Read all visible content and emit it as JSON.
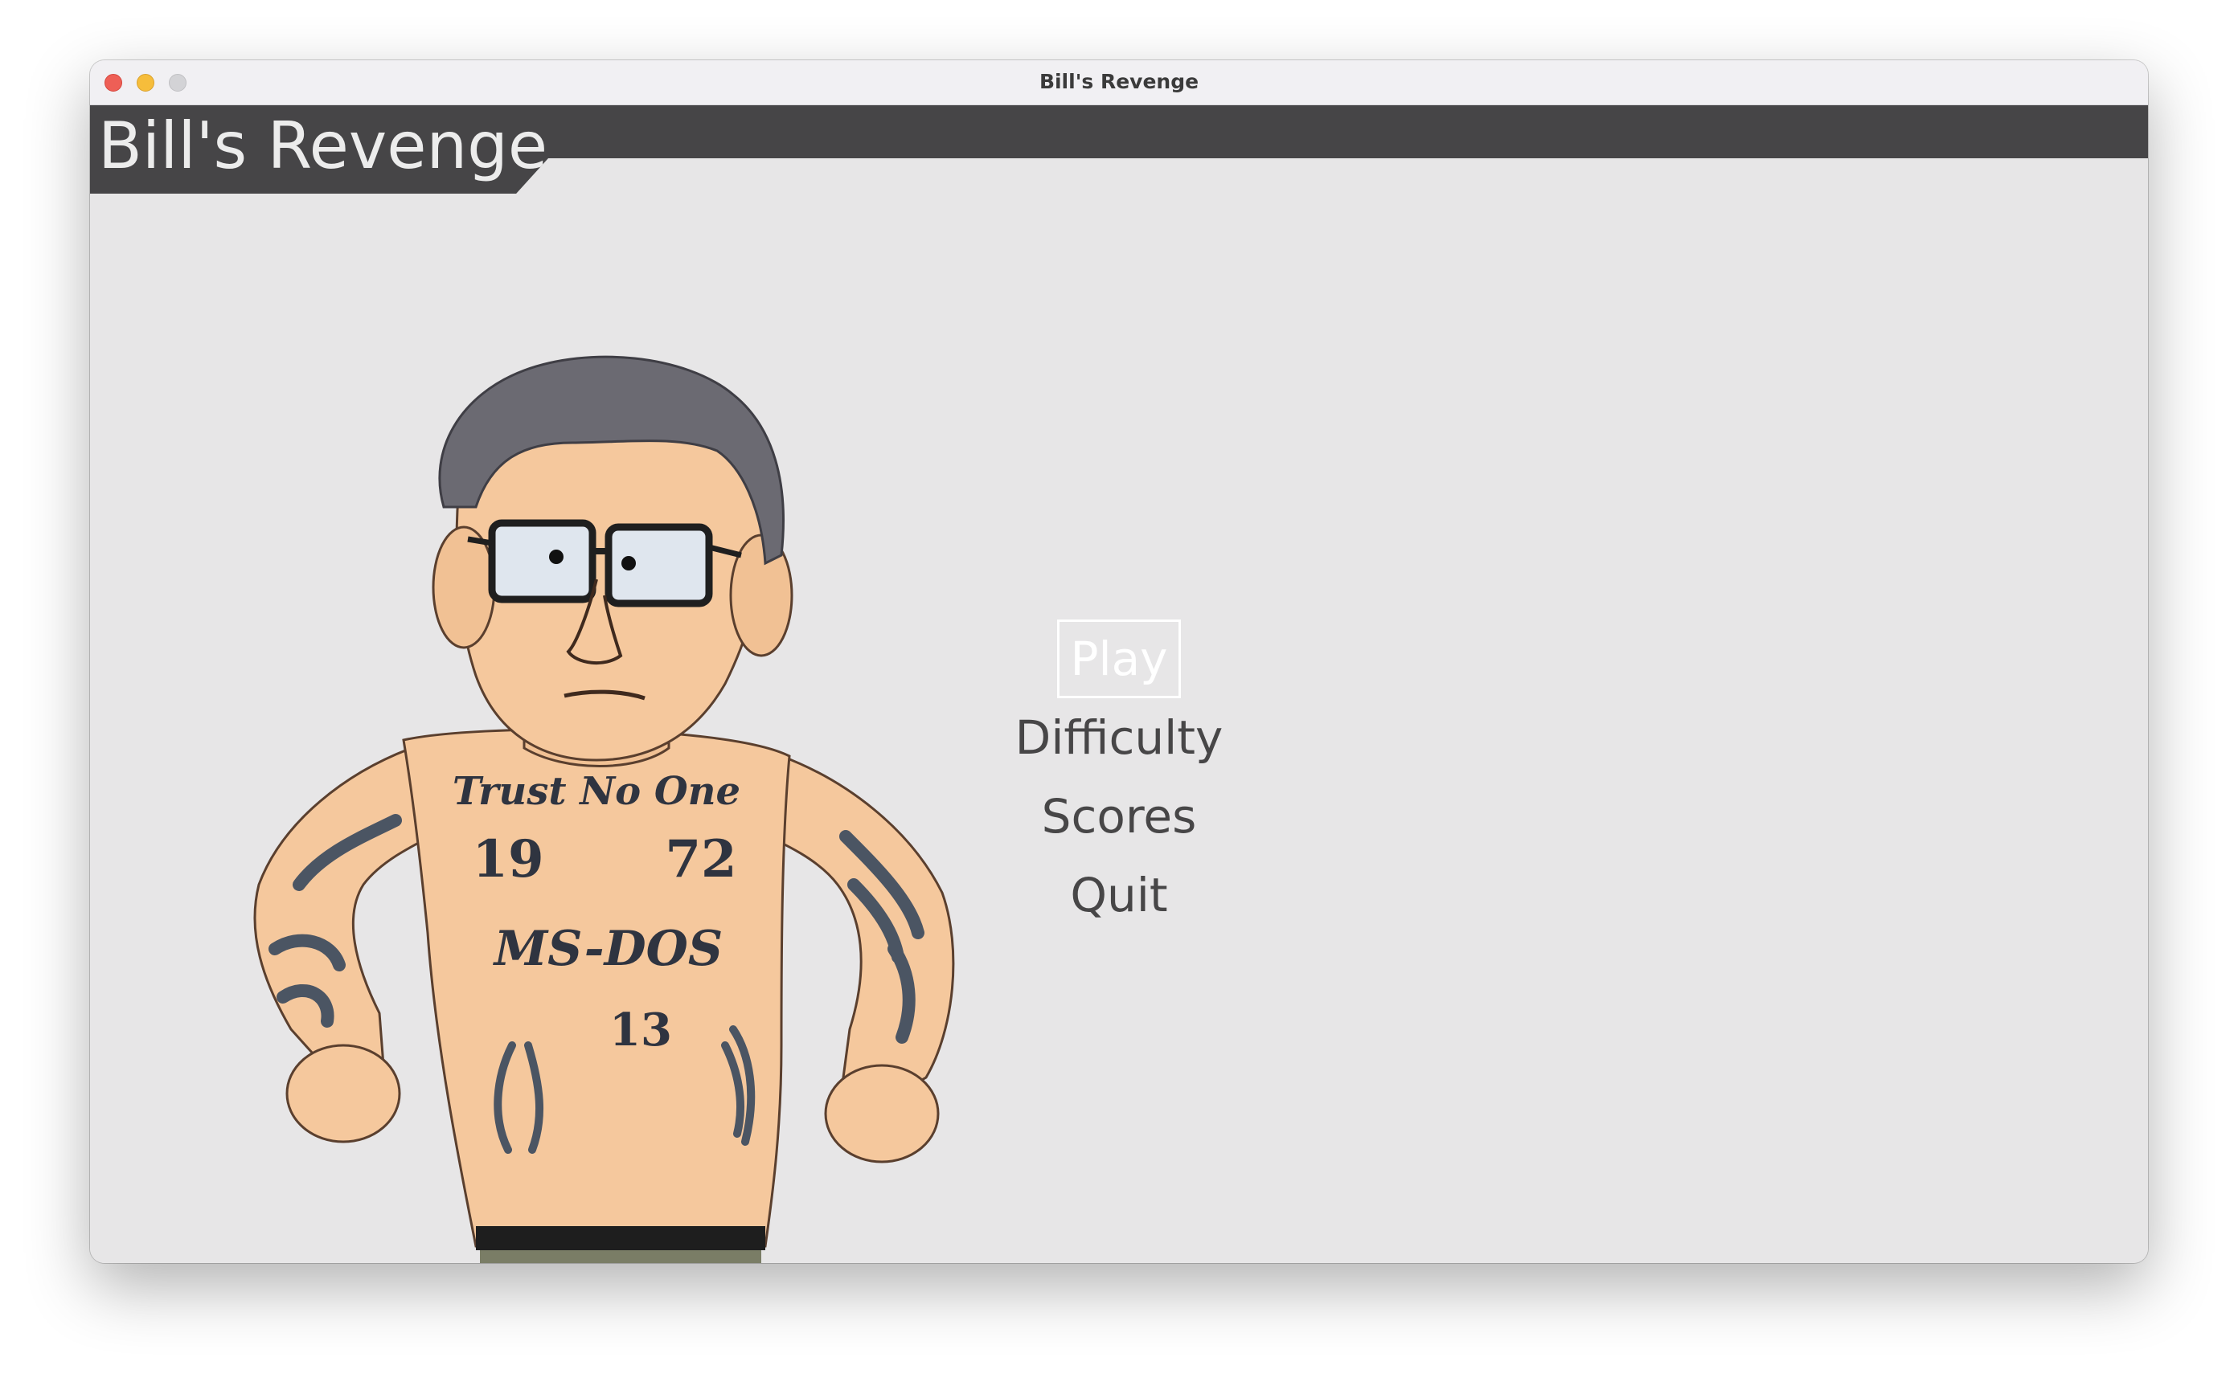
{
  "window": {
    "title": "Bill's Revenge"
  },
  "game": {
    "title": "Bill's Revenge",
    "banner_color": "#464547",
    "background_color": "#e7e6e7"
  },
  "character": {
    "tattoos": {
      "chest_text": "Trust No One",
      "year_left": "19",
      "year_right": "72",
      "belly_text": "MS-DOS",
      "number": "13"
    }
  },
  "menu": {
    "selected_index": 0,
    "items": [
      {
        "id": "play",
        "label": "Play"
      },
      {
        "id": "difficulty",
        "label": "Difficulty"
      },
      {
        "id": "scores",
        "label": "Scores"
      },
      {
        "id": "quit",
        "label": "Quit"
      }
    ]
  }
}
